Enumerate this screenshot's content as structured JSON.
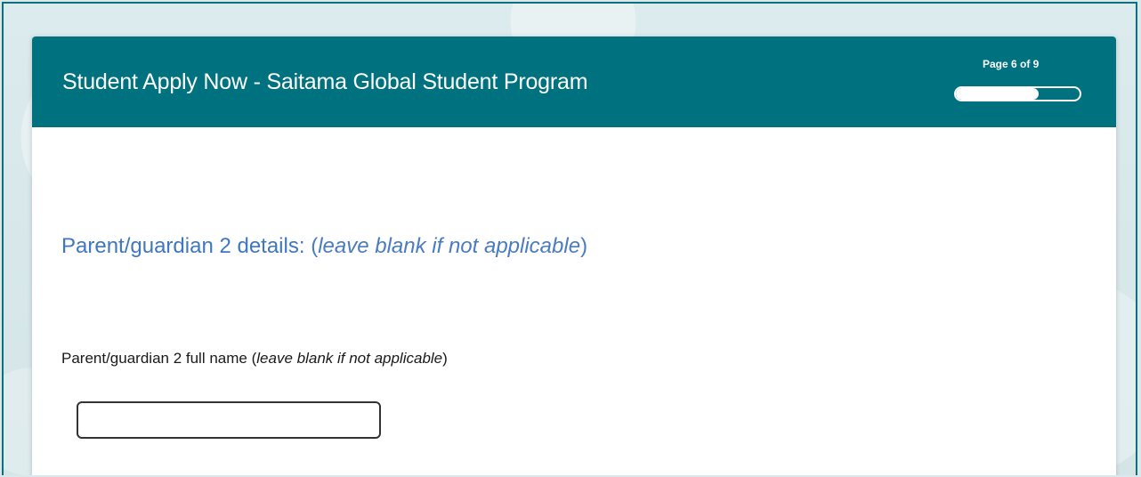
{
  "form": {
    "title": "Student Apply Now - Saitama Global Student Program",
    "page_indicator": "Page 6 of 9",
    "progress_fraction": 0.6667
  },
  "section": {
    "heading_label": "Parent/guardian 2 details:",
    "heading_note_open": "(",
    "heading_note": "leave blank if not applicable",
    "heading_note_close": ")"
  },
  "fields": {
    "parent2_full_name": {
      "label": "Parent/guardian 2 full name",
      "note_open": "(",
      "note": "leave blank if not applicable",
      "note_close": ")",
      "value": "",
      "placeholder": ""
    }
  },
  "colors": {
    "header_background": "#00727f",
    "heading_text": "#4a7cc1"
  }
}
